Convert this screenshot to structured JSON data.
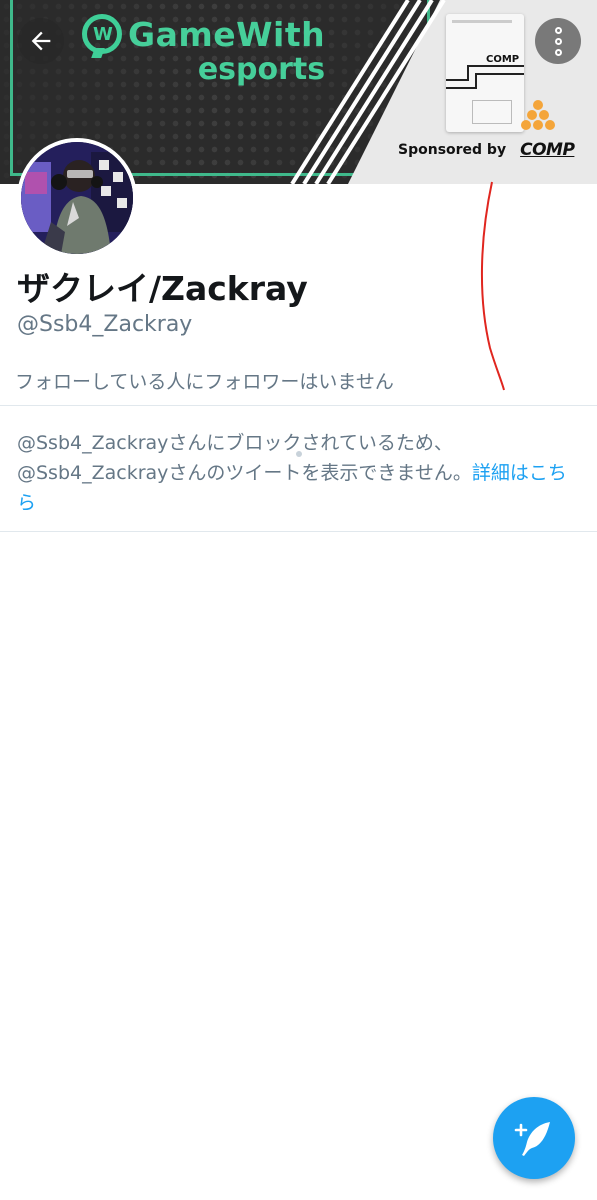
{
  "banner": {
    "logo_text": "GameWith",
    "logo_sub": "esports",
    "product_brand": "COMP",
    "sponsor_text": "Sponsored by",
    "sponsor_logo": "COMP"
  },
  "header": {
    "back_icon": "arrow-left-icon",
    "more_icon": "more-vertical-icon"
  },
  "profile": {
    "display_name": "ザクレイ/Zackray",
    "handle": "@Ssb4_Zackray",
    "followers_you_know": "フォローしている人にフォロワーはいません"
  },
  "blocked_notice": {
    "text": "@Ssb4_Zackrayさんにブロックされているため、@Ssb4_Zackrayさんのツイートを表示できません。",
    "link": "詳細はこちら"
  },
  "fab": {
    "icon": "compose-tweet-icon"
  },
  "colors": {
    "accent": "#1da1f2",
    "banner_green": "#46cf9a",
    "text_primary": "#14171a",
    "text_secondary": "#657786"
  }
}
